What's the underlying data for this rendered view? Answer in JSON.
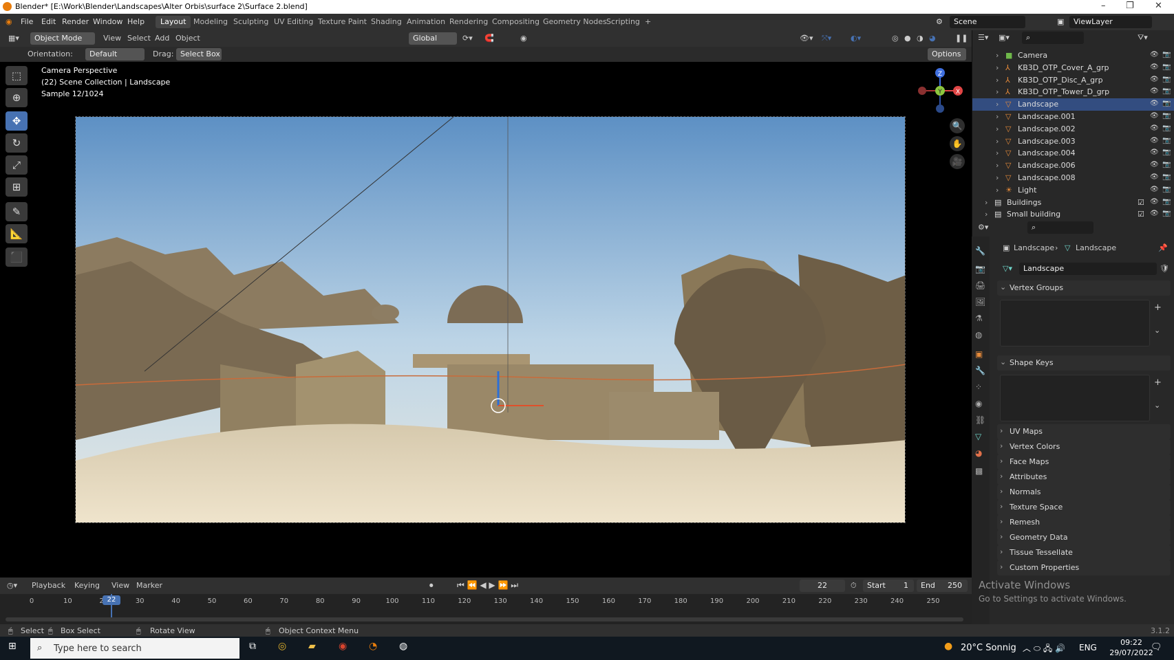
{
  "window": {
    "title": "Blender* [E:\\Work\\Blender\\Landscapes\\Alter Orbis\\surface 2\\Surface 2.blend]",
    "controls": [
      "–",
      "❐",
      "✕"
    ]
  },
  "menu": {
    "items": [
      "File",
      "Edit",
      "Render",
      "Window",
      "Help"
    ],
    "workspaces": [
      "Layout",
      "Modeling",
      "Sculpting",
      "UV Editing",
      "Texture Paint",
      "Shading",
      "Animation",
      "Rendering",
      "Compositing",
      "Geometry Nodes",
      "Scripting",
      "+"
    ],
    "active_workspace": "Layout",
    "scene": "Scene",
    "view_layer": "ViewLayer"
  },
  "viewport_header": {
    "mode": "Object Mode",
    "menus": [
      "View",
      "Select",
      "Add",
      "Object"
    ],
    "transform": "Global",
    "orientation_label": "Orientation:",
    "orientation_value": "Default",
    "drag_label": "Drag:",
    "drag_value": "Select Box",
    "options": "Options"
  },
  "viewport_overlay": {
    "line1": "Camera Perspective",
    "line2": "(22) Scene Collection | Landscape",
    "line3": "Sample 12/1024"
  },
  "gizmo": {
    "x": "X",
    "y": "Y",
    "z": "Z"
  },
  "outliner": {
    "rows": [
      {
        "name": "Camera",
        "icon": "camera-icon"
      },
      {
        "name": "KB3D_OTP_Cover_A_grp",
        "icon": "empty-icon"
      },
      {
        "name": "KB3D_OTP_Disc_A_grp",
        "icon": "empty-icon"
      },
      {
        "name": "KB3D_OTP_Tower_D_grp",
        "icon": "empty-icon"
      },
      {
        "name": "Landscape",
        "icon": "mesh-icon",
        "selected": true
      },
      {
        "name": "Landscape.001",
        "icon": "mesh-icon"
      },
      {
        "name": "Landscape.002",
        "icon": "mesh-icon"
      },
      {
        "name": "Landscape.003",
        "icon": "mesh-icon"
      },
      {
        "name": "Landscape.004",
        "icon": "mesh-icon"
      },
      {
        "name": "Landscape.006",
        "icon": "mesh-icon"
      },
      {
        "name": "Landscape.008",
        "icon": "mesh-icon"
      },
      {
        "name": "Light",
        "icon": "light-icon"
      },
      {
        "name": "Buildings",
        "icon": "collection-icon"
      },
      {
        "name": "Small building",
        "icon": "collection-icon"
      }
    ]
  },
  "properties": {
    "breadcrumb_object": "Landscape",
    "breadcrumb_data": "Landscape",
    "mesh_name": "Landscape",
    "sections_open": [
      "Vertex Groups",
      "Shape Keys"
    ],
    "sections_closed": [
      "UV Maps",
      "Vertex Colors",
      "Face Maps",
      "Attributes",
      "Normals",
      "Texture Space",
      "Remesh",
      "Geometry Data",
      "Tissue Tessellate",
      "Custom Properties"
    ]
  },
  "activate_windows": {
    "title": "Activate Windows",
    "subtitle": "Go to Settings to activate Windows."
  },
  "timeline": {
    "menus": [
      "Playback",
      "Keying",
      "View",
      "Marker"
    ],
    "current_frame": "22",
    "start_label": "Start",
    "start_value": "1",
    "end_label": "End",
    "end_value": "250",
    "ticks": [
      "0",
      "10",
      "20",
      "30",
      "40",
      "50",
      "60",
      "70",
      "80",
      "90",
      "100",
      "110",
      "120",
      "130",
      "140",
      "150",
      "160",
      "170",
      "180",
      "190",
      "200",
      "210",
      "220",
      "230",
      "240",
      "250"
    ]
  },
  "status_bar": {
    "select": "Select",
    "box_select": "Box Select",
    "rotate_view": "Rotate View",
    "context_menu": "Object Context Menu",
    "version": "3.1.2"
  },
  "taskbar": {
    "search_placeholder": "Type here to search",
    "weather": "20°C  Sonnig",
    "language": "ENG",
    "time": "09:22",
    "date": "29/07/2022"
  },
  "colors": {
    "accent": "#4772b3",
    "selected_row": "#334d80",
    "blender_orange": "#e87d0d"
  }
}
